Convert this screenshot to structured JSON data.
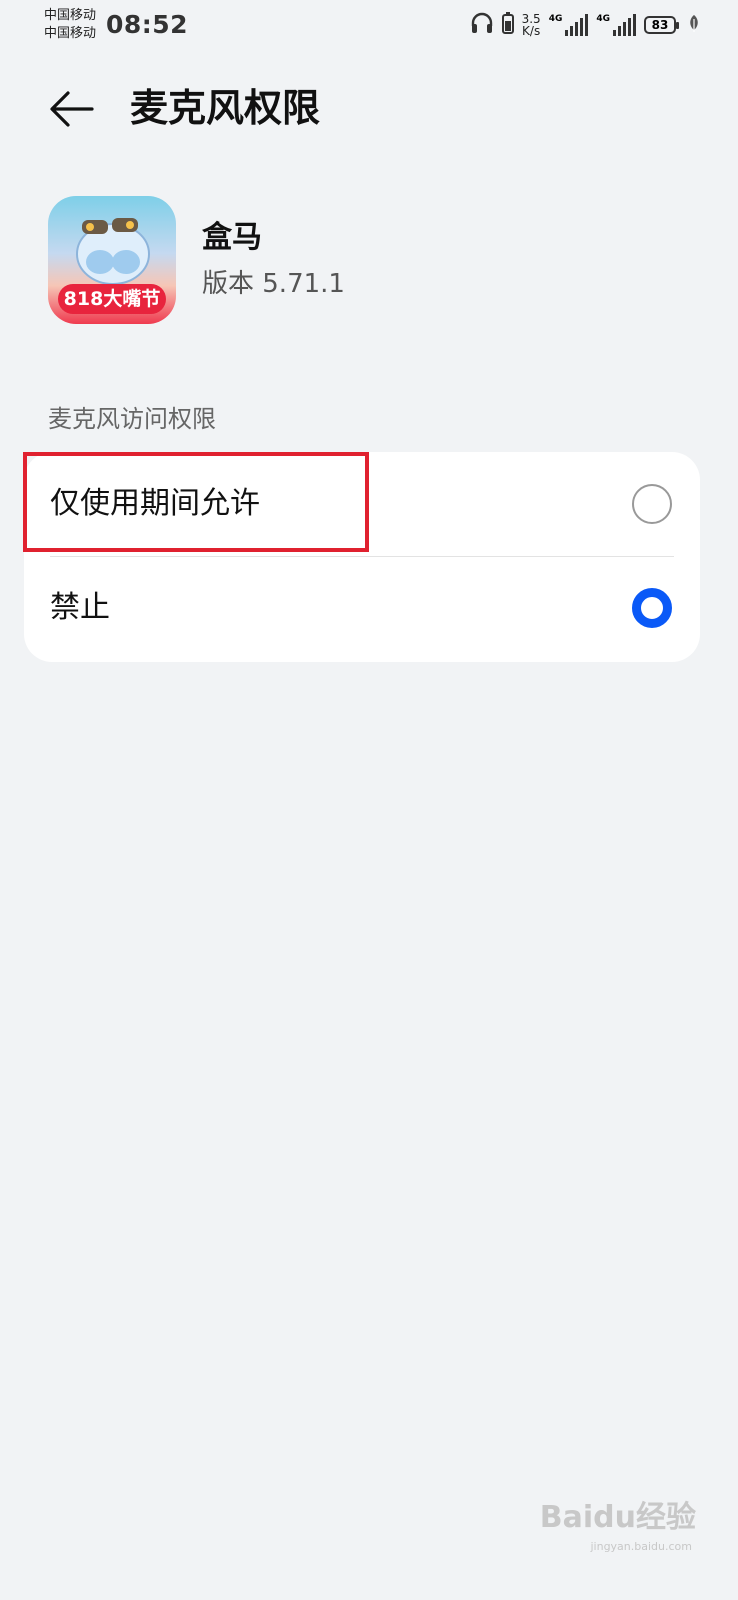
{
  "status_bar": {
    "carrier_1": "中国移动",
    "carrier_2": "中国移动",
    "time": "08:52",
    "net_speed_value": "3.5",
    "net_speed_unit": "K/s",
    "signal_1_label": "4G",
    "signal_2_label": "4G",
    "battery": "83",
    "icons": [
      "headphones-icon",
      "battery-saver-icon",
      "signal-icon",
      "battery-icon",
      "leaf-icon"
    ]
  },
  "header": {
    "title": "麦克风权限",
    "back_icon": "arrow-left-icon"
  },
  "app": {
    "name": "盒马",
    "version": "版本 5.71.1",
    "icon_banner": "818大嘴节"
  },
  "permission": {
    "section_label": "麦克风访问权限",
    "options": [
      {
        "label": "仅使用期间允许",
        "selected": false
      },
      {
        "label": "禁止",
        "selected": true
      }
    ]
  },
  "annotation": {
    "highlight_color": "#e0212f"
  },
  "accent_color": "#0a59f7",
  "watermark": {
    "text": "Baidu经验",
    "sub": "jingyan.baidu.com"
  }
}
